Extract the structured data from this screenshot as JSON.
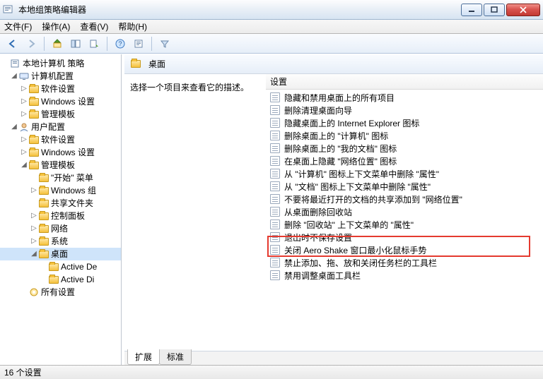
{
  "window": {
    "title": "本地组策略编辑器"
  },
  "menu": {
    "file": "文件(F)",
    "action": "操作(A)",
    "view": "查看(V)",
    "help": "帮助(H)"
  },
  "tree": {
    "root": "本地计算机 策略",
    "computer_cfg": "计算机配置",
    "software_settings_a": "软件设置",
    "windows_settings_a": "Windows 设置",
    "admin_templates_a": "管理模板",
    "user_cfg": "用户配置",
    "software_settings_b": "软件设置",
    "windows_settings_b": "Windows 设置",
    "admin_templates_b": "管理模板",
    "start_menu": "\"开始\" 菜单",
    "windows_components": "Windows 组",
    "shared_folders": "共享文件夹",
    "control_panel": "控制面板",
    "network": "网络",
    "system": "系统",
    "desktop": "桌面",
    "active_de": "Active De",
    "active_di": "Active Di",
    "all_settings": "所有设置"
  },
  "right": {
    "header_label": "桌面",
    "prompt": "选择一个项目来查看它的描述。",
    "column_header": "设置",
    "items": [
      "隐藏和禁用桌面上的所有项目",
      "删除清理桌面向导",
      "隐藏桌面上的 Internet Explorer 图标",
      "删除桌面上的 \"计算机\" 图标",
      "删除桌面上的 \"我的文档\" 图标",
      "在桌面上隐藏 \"网络位置\" 图标",
      "从 \"计算机\" 图标上下文菜单中删除 \"属性\"",
      "从 \"文档\" 图标上下文菜单中删除 \"属性\"",
      "不要将最近打开的文档的共享添加到 \"网络位置\"",
      "从桌面删除回收站",
      "删除 \"回收站\" 上下文菜单的 \"属性\"",
      "退出时不保存设置",
      "关闭 Aero Shake 窗口最小化鼠标手势",
      "禁止添加、拖、放和关闭任务栏的工具栏",
      "禁用调整桌面工具栏"
    ],
    "highlight_index": 12
  },
  "tabs": {
    "extended": "扩展",
    "standard": "标准"
  },
  "status": "16 个设置"
}
